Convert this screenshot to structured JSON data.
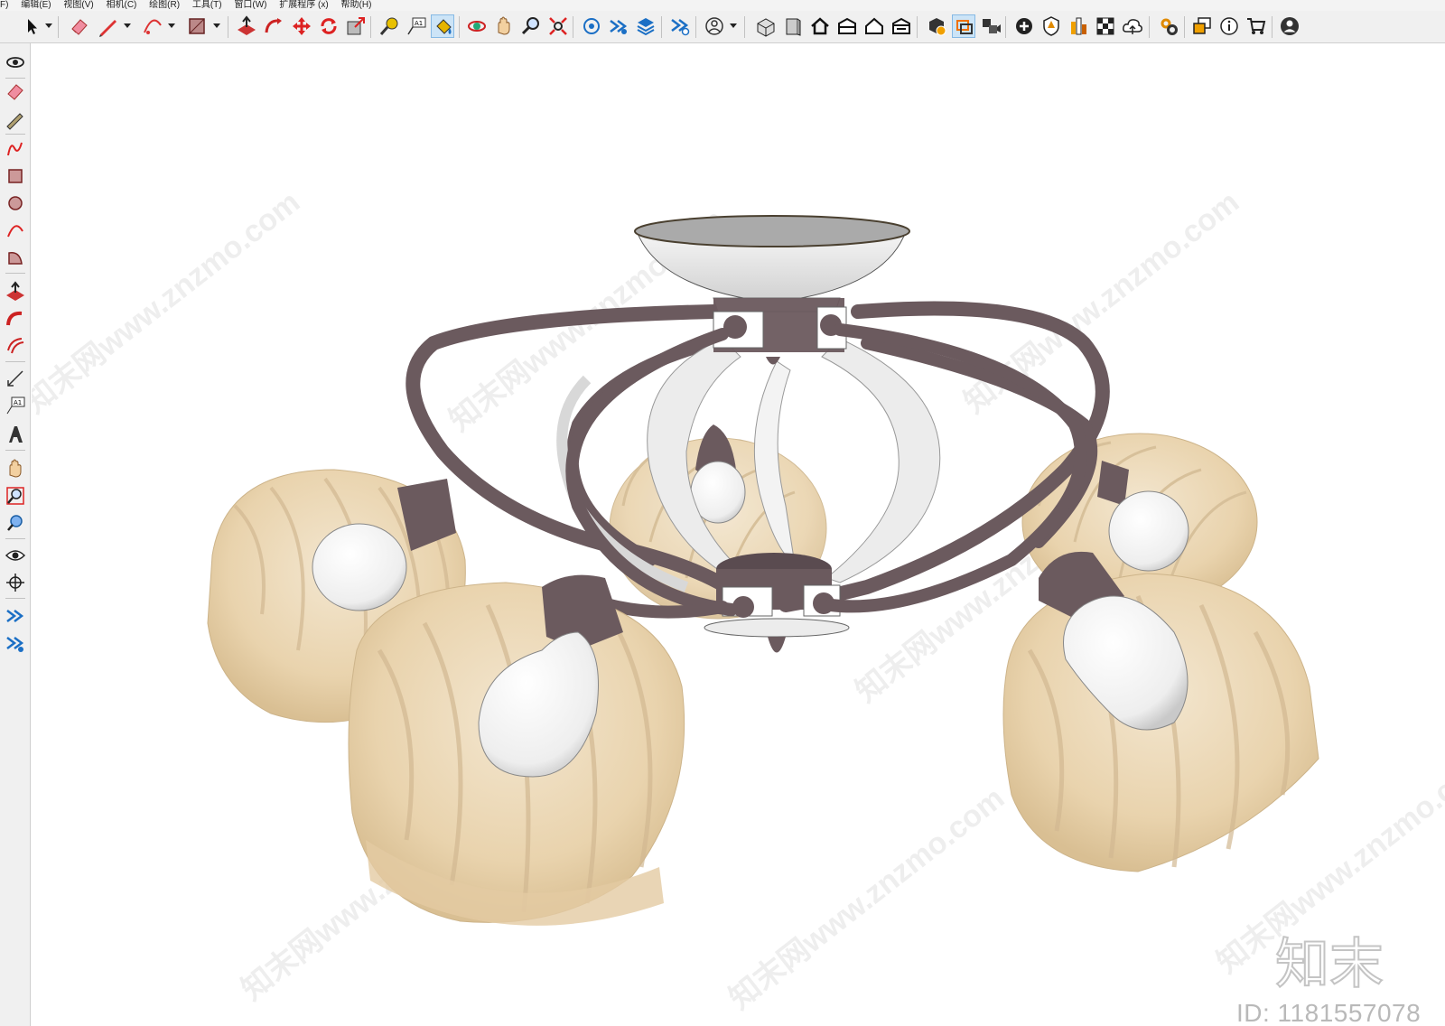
{
  "menu": [
    "F)",
    "编辑(E)",
    "视图(V)",
    "相机(C)",
    "绘图(R)",
    "工具(T)",
    "窗口(W)",
    "扩展程序 (x)",
    "帮助(H)"
  ],
  "toolbar_icons": [
    "select-icon",
    "eraser-icon",
    "pencil-line-icon",
    "arc-icon",
    "rectangle-icon",
    "push-pull-icon",
    "follow-me-icon",
    "move-icon",
    "rotate-icon",
    "scale-icon",
    "tape-measure-icon",
    "text-label-icon",
    "paint-bucket-icon",
    "orbit-icon",
    "pan-icon",
    "zoom-icon",
    "zoom-extents-icon",
    "warehouse-icon",
    "extension-icon",
    "layers-icon",
    "extension-manager-icon",
    "user-icon",
    "iso-view-icon",
    "front-view-icon",
    "home-icon",
    "right-view-icon",
    "back-view-icon",
    "left-view-icon",
    "section-plane-icon",
    "section-display-icon",
    "camera-scene-icon",
    "add-location-icon",
    "shield-icon",
    "shadow-icon",
    "checker-icon",
    "cloud-icon",
    "settings-icon",
    "components-icon",
    "info-icon",
    "cart-icon",
    "account-icon"
  ],
  "left_toolbar_icons": [
    "orbit-icon",
    "eraser-icon",
    "pencil-icon",
    "freehand-icon",
    "rectangle-icon",
    "circle-icon",
    "arc-icon",
    "pie-icon",
    "push-pull-icon",
    "follow-me-icon",
    "offset-icon",
    "dimension-icon",
    "text-icon",
    "3d-text-icon",
    "pan-icon",
    "zoom-window-icon",
    "zoom-extents-icon",
    "look-around-icon",
    "walk-icon",
    "extension-a-icon",
    "extension-b-icon"
  ],
  "watermark": {
    "text": "知末网www.znzmo.com",
    "brand": "知末",
    "id_text": "ID: 1181557078"
  },
  "colors": {
    "frame": "#6b5a5e",
    "glass": "#e8d5b4",
    "bulb": "#f2f2f2",
    "white_band": "#ececec"
  }
}
